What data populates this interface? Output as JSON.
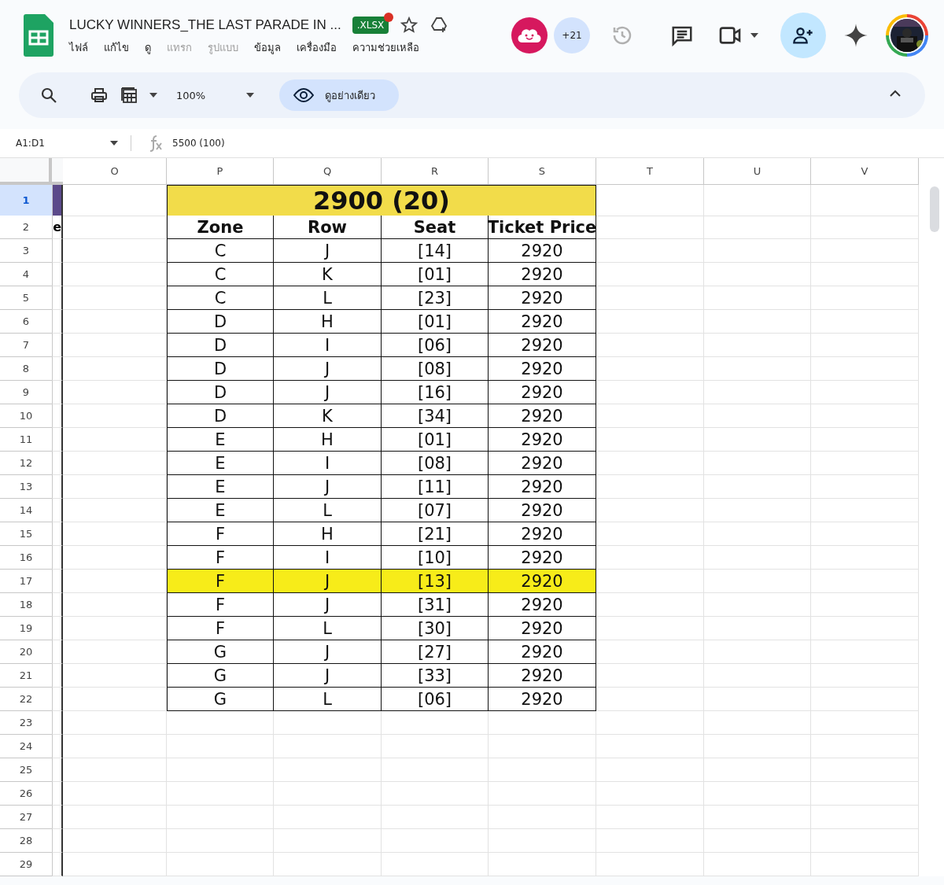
{
  "document": {
    "title": "LUCKY WINNERS_THE LAST PARADE IN ...",
    "badge": ".XLSX"
  },
  "menu": [
    {
      "label": "ไฟล์",
      "disabled": false
    },
    {
      "label": "แก้ไข",
      "disabled": false
    },
    {
      "label": "ดู",
      "disabled": false
    },
    {
      "label": "แทรก",
      "disabled": true
    },
    {
      "label": "รูปแบบ",
      "disabled": true
    },
    {
      "label": "ข้อมูล",
      "disabled": false
    },
    {
      "label": "เครื่องมือ",
      "disabled": false
    },
    {
      "label": "ความช่วยเหลือ",
      "disabled": false
    }
  ],
  "collaborators": {
    "more": "+21"
  },
  "toolbar": {
    "zoom": "100%",
    "view_mode": "ดูอย่างเดียว"
  },
  "formula_bar": {
    "range": "A1:D1",
    "value": "5500 (100)"
  },
  "columns": [
    "O",
    "P",
    "Q",
    "R",
    "S",
    "T",
    "U",
    "V"
  ],
  "frozen_column_text": "e",
  "row_numbers": [
    {
      "label": "1",
      "selected": true
    },
    {
      "label": "2",
      "selected": false
    },
    {
      "label": "3",
      "selected": false
    },
    {
      "label": "4",
      "selected": false
    },
    {
      "label": "5",
      "selected": false
    },
    {
      "label": "6",
      "selected": false
    },
    {
      "label": "7",
      "selected": false
    },
    {
      "label": "8",
      "selected": false
    },
    {
      "label": "9",
      "selected": false
    },
    {
      "label": "10",
      "selected": false
    },
    {
      "label": "11",
      "selected": false
    },
    {
      "label": "12",
      "selected": false
    },
    {
      "label": "13",
      "selected": false
    },
    {
      "label": "14",
      "selected": false
    },
    {
      "label": "15",
      "selected": false
    },
    {
      "label": "16",
      "selected": false
    },
    {
      "label": "17",
      "selected": false
    },
    {
      "label": "18",
      "selected": false
    },
    {
      "label": "19",
      "selected": false
    },
    {
      "label": "20",
      "selected": false
    },
    {
      "label": "21",
      "selected": false
    },
    {
      "label": "22",
      "selected": false
    },
    {
      "label": "23",
      "selected": false
    },
    {
      "label": "24",
      "selected": false
    },
    {
      "label": "25",
      "selected": false
    },
    {
      "label": "26",
      "selected": false
    },
    {
      "label": "27",
      "selected": false
    },
    {
      "label": "28",
      "selected": false
    },
    {
      "label": "29",
      "selected": false
    }
  ],
  "table": {
    "title": "2900 (20)",
    "headers": [
      "Zone",
      "Row",
      "Seat",
      "Ticket Price"
    ],
    "rows": [
      {
        "cells": [
          "C",
          "J",
          "[14]",
          "2920"
        ],
        "highlighted": false
      },
      {
        "cells": [
          "C",
          "K",
          "[01]",
          "2920"
        ],
        "highlighted": false
      },
      {
        "cells": [
          "C",
          "L",
          "[23]",
          "2920"
        ],
        "highlighted": false
      },
      {
        "cells": [
          "D",
          "H",
          "[01]",
          "2920"
        ],
        "highlighted": false
      },
      {
        "cells": [
          "D",
          "I",
          "[06]",
          "2920"
        ],
        "highlighted": false
      },
      {
        "cells": [
          "D",
          "J",
          "[08]",
          "2920"
        ],
        "highlighted": false
      },
      {
        "cells": [
          "D",
          "J",
          "[16]",
          "2920"
        ],
        "highlighted": false
      },
      {
        "cells": [
          "D",
          "K",
          "[34]",
          "2920"
        ],
        "highlighted": false
      },
      {
        "cells": [
          "E",
          "H",
          "[01]",
          "2920"
        ],
        "highlighted": false
      },
      {
        "cells": [
          "E",
          "I",
          "[08]",
          "2920"
        ],
        "highlighted": false
      },
      {
        "cells": [
          "E",
          "J",
          "[11]",
          "2920"
        ],
        "highlighted": false
      },
      {
        "cells": [
          "E",
          "L",
          "[07]",
          "2920"
        ],
        "highlighted": false
      },
      {
        "cells": [
          "F",
          "H",
          "[21]",
          "2920"
        ],
        "highlighted": false
      },
      {
        "cells": [
          "F",
          "I",
          "[10]",
          "2920"
        ],
        "highlighted": false
      },
      {
        "cells": [
          "F",
          "J",
          "[13]",
          "2920"
        ],
        "highlighted": true
      },
      {
        "cells": [
          "F",
          "J",
          "[31]",
          "2920"
        ],
        "highlighted": false
      },
      {
        "cells": [
          "F",
          "L",
          "[30]",
          "2920"
        ],
        "highlighted": false
      },
      {
        "cells": [
          "G",
          "J",
          "[27]",
          "2920"
        ],
        "highlighted": false
      },
      {
        "cells": [
          "G",
          "J",
          "[33]",
          "2920"
        ],
        "highlighted": false
      },
      {
        "cells": [
          "G",
          "L",
          "[06]",
          "2920"
        ],
        "highlighted": false
      }
    ]
  }
}
